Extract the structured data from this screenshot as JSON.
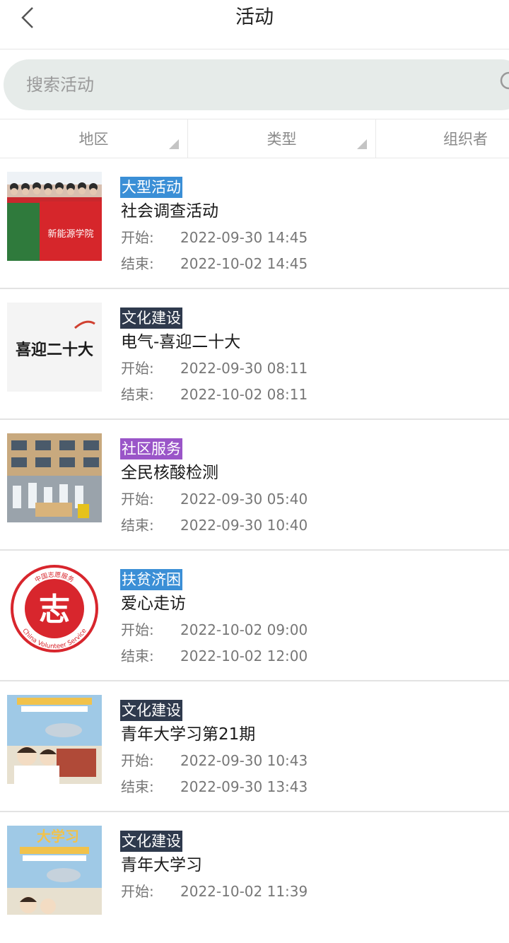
{
  "header": {
    "title": "活动",
    "back_icon": "chevron-left-icon"
  },
  "search": {
    "placeholder": "搜索活动",
    "value": "",
    "icon": "search-icon"
  },
  "filters": [
    {
      "label": "地区"
    },
    {
      "label": "类型"
    },
    {
      "label": "组织者"
    }
  ],
  "activities": [
    {
      "tag": "大型活动",
      "tag_color": "#3b8fd6",
      "name": "社会调查活动",
      "start_label": "开始:",
      "start": "2022-09-30 14:45",
      "end_label": "结束:",
      "end": "2022-10-02 14:45"
    },
    {
      "tag": "文化建设",
      "tag_color": "#2f3a4d",
      "name": "电气-喜迎二十大",
      "start_label": "开始:",
      "start": "2022-09-30 08:11",
      "end_label": "结束:",
      "end": "2022-10-02 08:11"
    },
    {
      "tag": "社区服务",
      "tag_color": "#9a55c8",
      "name": "全民核酸检测",
      "start_label": "开始:",
      "start": "2022-09-30 05:40",
      "end_label": "结束:",
      "end": "2022-09-30 10:40"
    },
    {
      "tag": "扶贫济困",
      "tag_color": "#3b8fd6",
      "name": "爱心走访",
      "start_label": "开始:",
      "start": "2022-10-02 09:00",
      "end_label": "结束:",
      "end": "2022-10-02 12:00"
    },
    {
      "tag": "文化建设",
      "tag_color": "#2f3a4d",
      "name": "青年大学习第21期",
      "start_label": "开始:",
      "start": "2022-09-30 10:43",
      "end_label": "结束:",
      "end": "2022-09-30 13:43"
    },
    {
      "tag": "文化建设",
      "tag_color": "#2f3a4d",
      "name": "青年大学习",
      "start_label": "开始:",
      "start": "2022-10-02 11:39",
      "end_label": "结束:",
      "end": ""
    }
  ],
  "thumb_texts": {
    "banner_text": "新能源学院",
    "calligraphy": "喜迎二十大",
    "logo_cn": "中国志愿服务",
    "logo_en": "China Volunteer Service",
    "logo_char": "志",
    "poster_title": "大学习"
  }
}
